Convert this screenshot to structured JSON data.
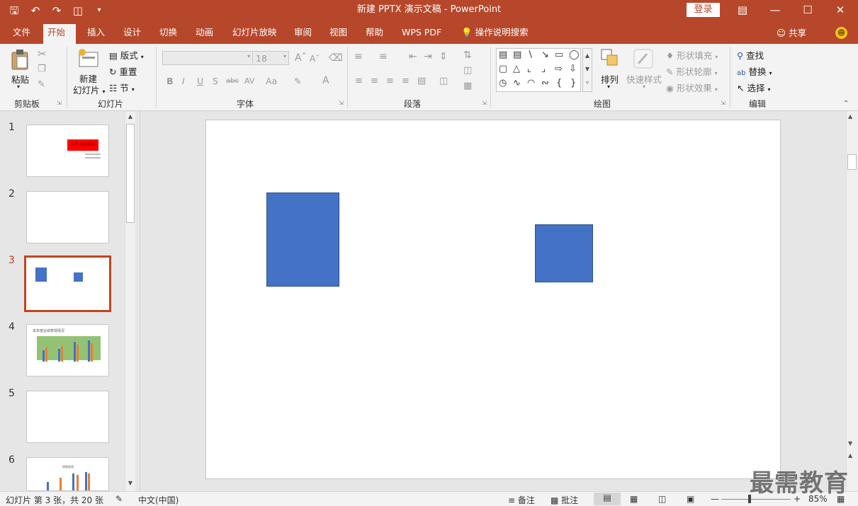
{
  "titlebar": {
    "title": "新建 PPTX 演示文稿  -  PowerPoint",
    "login_label": "登录"
  },
  "tabs": [
    {
      "label": "文件"
    },
    {
      "label": "开始"
    },
    {
      "label": "插入"
    },
    {
      "label": "设计"
    },
    {
      "label": "切换"
    },
    {
      "label": "动画"
    },
    {
      "label": "幻灯片放映"
    },
    {
      "label": "审阅"
    },
    {
      "label": "视图"
    },
    {
      "label": "帮助"
    },
    {
      "label": "WPS PDF"
    },
    {
      "label": "操作说明搜索"
    }
  ],
  "share_label": "共享",
  "ribbon": {
    "clipboard": {
      "paste": "粘贴",
      "group": "剪贴板"
    },
    "slides": {
      "new_slide_1": "新建",
      "new_slide_2": "幻灯片",
      "layout": "版式",
      "reset": "重置",
      "section": "节",
      "group": "幻灯片"
    },
    "font": {
      "size": "18",
      "group": "字体",
      "bold": "B",
      "italic": "I",
      "underline": "U",
      "shadow": "S",
      "strike": "abc",
      "spacing": "AV",
      "case": "Aa",
      "color": "A"
    },
    "paragraph": {
      "group": "段落"
    },
    "drawing": {
      "arrange": "排列",
      "quick_styles": "快速样式",
      "fill": "形状填充",
      "outline": "形状轮廓",
      "effects": "形状效果",
      "group": "绘图"
    },
    "editing": {
      "find": "查找",
      "replace": "替换",
      "select": "选择",
      "group": "编辑"
    }
  },
  "thumbnails": [
    {
      "num": "1",
      "title_text": "工作总结报告"
    },
    {
      "num": "2"
    },
    {
      "num": "3",
      "selected": true
    },
    {
      "num": "4",
      "title_text": "本年度业绩表现情况"
    },
    {
      "num": "5"
    },
    {
      "num": "6",
      "title_text": "销售报表"
    }
  ],
  "status": {
    "slide_info": "幻灯片 第 3 张，共 20 张",
    "language": "中文(中国)",
    "notes": "备注",
    "comments": "批注",
    "zoom": "85%"
  },
  "watermark": "最需教育",
  "colors": {
    "accent": "#b7472a",
    "shape_fill": "#4472c4",
    "selected_thumb_border": "#c0461f"
  }
}
